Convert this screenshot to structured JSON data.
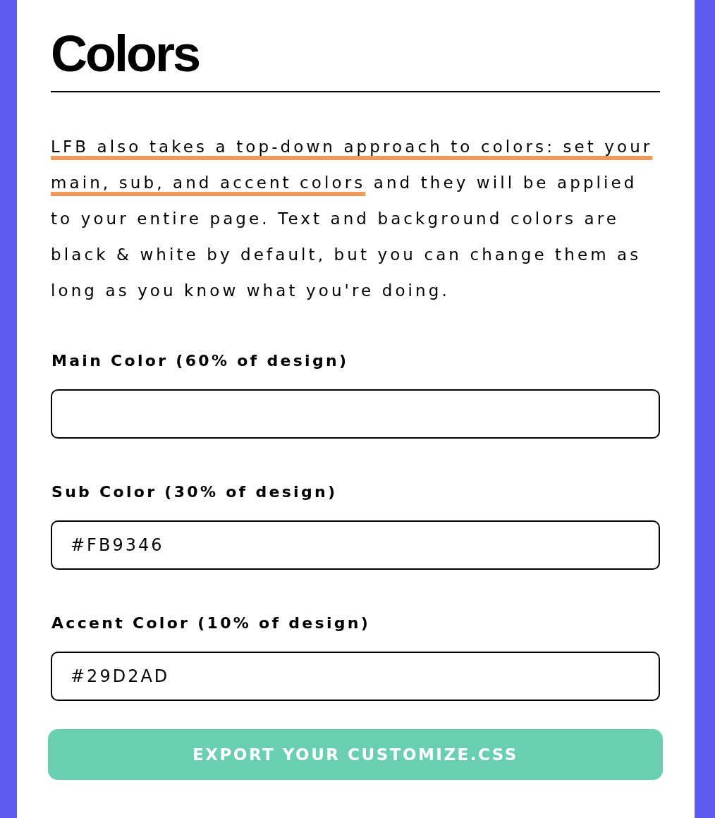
{
  "heading": {
    "title": "Colors"
  },
  "intro": {
    "segments": [
      {
        "text": "LFB also takes a top-down approach to colors: set your main, sub, and accent colors",
        "highlighted": true
      },
      {
        "text": " and they will be applied to your entire page. Text and background colors are black & white by default, but you can change them as long as you know what you're doing.",
        "highlighted": false
      }
    ]
  },
  "fields": [
    {
      "label": "Main Color (60% of design)"
    },
    {
      "label": "Sub Color (30% of design)",
      "value": "#FB9346"
    },
    {
      "label": "Accent Color (10% of design)",
      "value": "#29D2AD"
    }
  ],
  "export_button": {
    "label": "EXPORT YOUR CUSTOMIZE.CSS"
  }
}
